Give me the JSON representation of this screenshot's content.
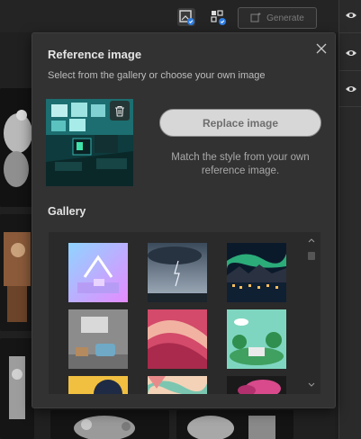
{
  "toolbar": {
    "generate_label": "Generate",
    "icons": [
      "reference-image-icon",
      "structure-reference-icon"
    ]
  },
  "popover": {
    "title": "Reference image",
    "subtitle": "Select from the gallery or choose your own image",
    "replace_button_label": "Replace image",
    "match_text": "Match the style from your own reference image.",
    "gallery_label": "Gallery"
  },
  "colors": {
    "panel_bg": "#323232",
    "button_bg": "#d7d7d7",
    "accent_badge": "#2f7de1"
  }
}
